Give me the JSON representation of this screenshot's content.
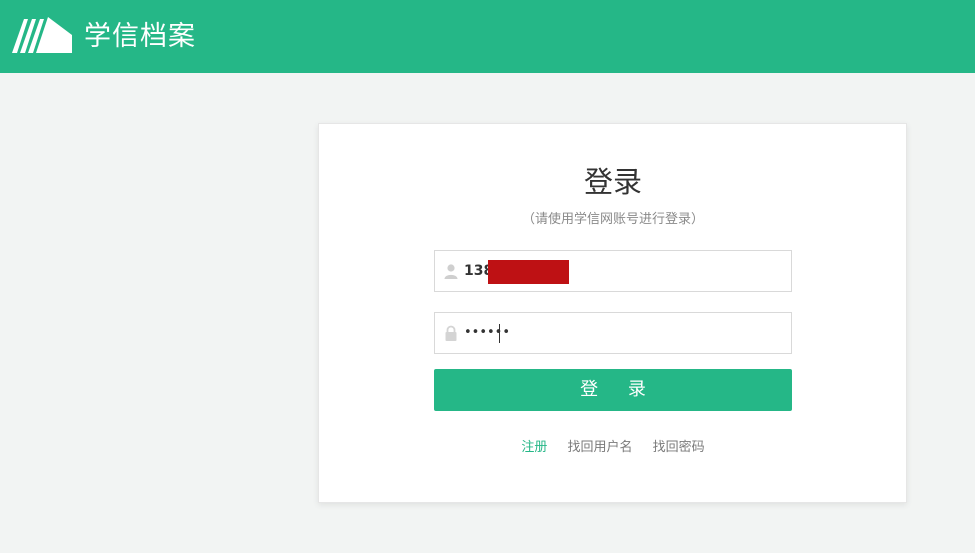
{
  "header": {
    "logo_icon": "open-book-icon",
    "logo_text": "学信档案",
    "background_color": "#25b787"
  },
  "login": {
    "title": "登录",
    "subtitle": "（请使用学信网账号进行登录）",
    "username": {
      "icon": "user-icon",
      "value": "138"
    },
    "password": {
      "icon": "lock-icon",
      "value": "••••••"
    },
    "button_label": "登 录",
    "button_color": "#25b787",
    "links": {
      "register": "注册",
      "find_username": "找回用户名",
      "find_password": "找回密码"
    }
  },
  "redaction_color": "#be1114"
}
